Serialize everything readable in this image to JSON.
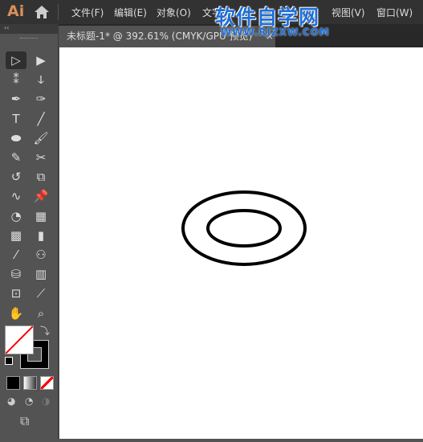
{
  "app": {
    "logo": "Ai"
  },
  "menu": [
    "文件(F)",
    "编辑(E)",
    "对象(O)",
    "文字",
    "视图(V)",
    "窗口(W)"
  ],
  "watermark": {
    "title": "软件自学网",
    "url": "WWW.RJZXW.COM"
  },
  "document_tab": {
    "title": "未标题-1* @ 392.61% (CMYK/GPU 预览)",
    "close": "×"
  },
  "toolbar": {
    "collapse": "‹‹",
    "tools": [
      [
        "selection-tool",
        "▷"
      ],
      [
        "direct-selection-tool",
        "▶"
      ],
      [
        "magic-wand-tool",
        "⁑"
      ],
      [
        "lasso-tool",
        "ↆ"
      ],
      [
        "pen-tool",
        "✒"
      ],
      [
        "curvature-tool",
        "✑"
      ],
      [
        "type-tool",
        "T"
      ],
      [
        "line-tool",
        "╱"
      ],
      [
        "ellipse-tool",
        "⬬"
      ],
      [
        "paintbrush-tool",
        "🖌"
      ],
      [
        "shaper-tool",
        "✎"
      ],
      [
        "scissors-tool",
        "✂"
      ],
      [
        "rotate-tool",
        "↺"
      ],
      [
        "scale-tool",
        "⧉"
      ],
      [
        "warp-tool",
        "∿"
      ],
      [
        "puppet-warp-tool",
        "📌"
      ],
      [
        "shape-builder-tool",
        "◔"
      ],
      [
        "perspective-grid-tool",
        "▦"
      ],
      [
        "mesh-tool",
        "▩"
      ],
      [
        "gradient-tool",
        "▮"
      ],
      [
        "eyedropper-tool",
        "⁄"
      ],
      [
        "blend-tool",
        "⚇"
      ],
      [
        "symbol-sprayer-tool",
        "⛁"
      ],
      [
        "column-graph-tool",
        "▥"
      ],
      [
        "artboard-tool",
        "⊡"
      ],
      [
        "slice-tool",
        "⟋"
      ],
      [
        "hand-tool",
        "✋"
      ],
      [
        "zoom-tool",
        "⌕"
      ]
    ]
  },
  "colors": {
    "fill": "none",
    "stroke": "#000000",
    "accent": "#d88f5a"
  },
  "artwork": {
    "shape": "concentric ellipses",
    "stroke_color": "#000000"
  }
}
